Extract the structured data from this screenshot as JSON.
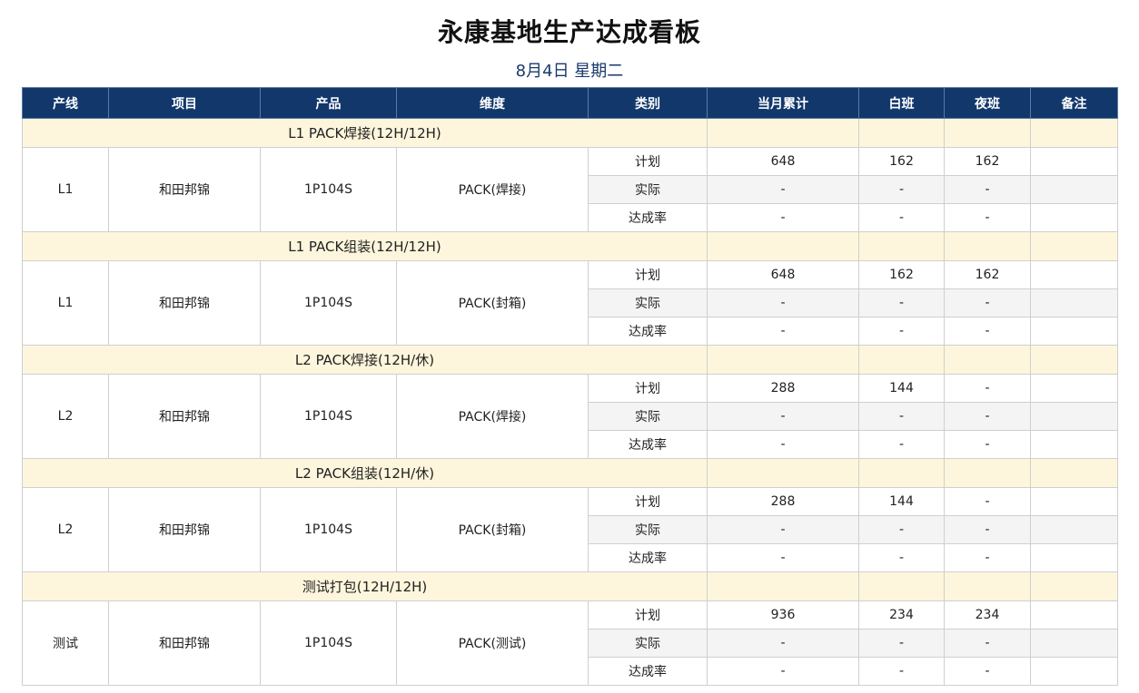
{
  "title": "永康基地生产达成看板",
  "subtitle": "8月4日 星期二",
  "headers": [
    "产线",
    "项目",
    "产品",
    "维度",
    "类别",
    "当月累计",
    "白班",
    "夜班",
    "备注"
  ],
  "groups": [
    {
      "title": "L1 PACK焊接(12H/12H)",
      "line": "L1",
      "project": "和田邦锦",
      "product": "1P104S",
      "dimension": "PACK(焊接)",
      "rows": [
        {
          "category": "计划",
          "month": "648",
          "day": "162",
          "night": "162",
          "note": ""
        },
        {
          "category": "实际",
          "month": "-",
          "day": "-",
          "night": "-",
          "note": ""
        },
        {
          "category": "达成率",
          "month": "-",
          "day": "-",
          "night": "-",
          "note": ""
        }
      ]
    },
    {
      "title": "L1 PACK组装(12H/12H)",
      "line": "L1",
      "project": "和田邦锦",
      "product": "1P104S",
      "dimension": "PACK(封箱)",
      "rows": [
        {
          "category": "计划",
          "month": "648",
          "day": "162",
          "night": "162",
          "note": ""
        },
        {
          "category": "实际",
          "month": "-",
          "day": "-",
          "night": "-",
          "note": ""
        },
        {
          "category": "达成率",
          "month": "-",
          "day": "-",
          "night": "-",
          "note": ""
        }
      ]
    },
    {
      "title": "L2 PACK焊接(12H/休)",
      "line": "L2",
      "project": "和田邦锦",
      "product": "1P104S",
      "dimension": "PACK(焊接)",
      "rows": [
        {
          "category": "计划",
          "month": "288",
          "day": "144",
          "night": "-",
          "note": ""
        },
        {
          "category": "实际",
          "month": "-",
          "day": "-",
          "night": "-",
          "note": ""
        },
        {
          "category": "达成率",
          "month": "-",
          "day": "-",
          "night": "-",
          "note": ""
        }
      ]
    },
    {
      "title": "L2 PACK组装(12H/休)",
      "line": "L2",
      "project": "和田邦锦",
      "product": "1P104S",
      "dimension": "PACK(封箱)",
      "rows": [
        {
          "category": "计划",
          "month": "288",
          "day": "144",
          "night": "-",
          "note": ""
        },
        {
          "category": "实际",
          "month": "-",
          "day": "-",
          "night": "-",
          "note": ""
        },
        {
          "category": "达成率",
          "month": "-",
          "day": "-",
          "night": "-",
          "note": ""
        }
      ]
    },
    {
      "title": "测试打包(12H/12H)",
      "line": "测试",
      "project": "和田邦锦",
      "product": "1P104S",
      "dimension": "PACK(测试)",
      "rows": [
        {
          "category": "计划",
          "month": "936",
          "day": "234",
          "night": "234",
          "note": ""
        },
        {
          "category": "实际",
          "month": "-",
          "day": "-",
          "night": "-",
          "note": ""
        },
        {
          "category": "达成率",
          "month": "-",
          "day": "-",
          "night": "-",
          "note": ""
        }
      ]
    }
  ]
}
